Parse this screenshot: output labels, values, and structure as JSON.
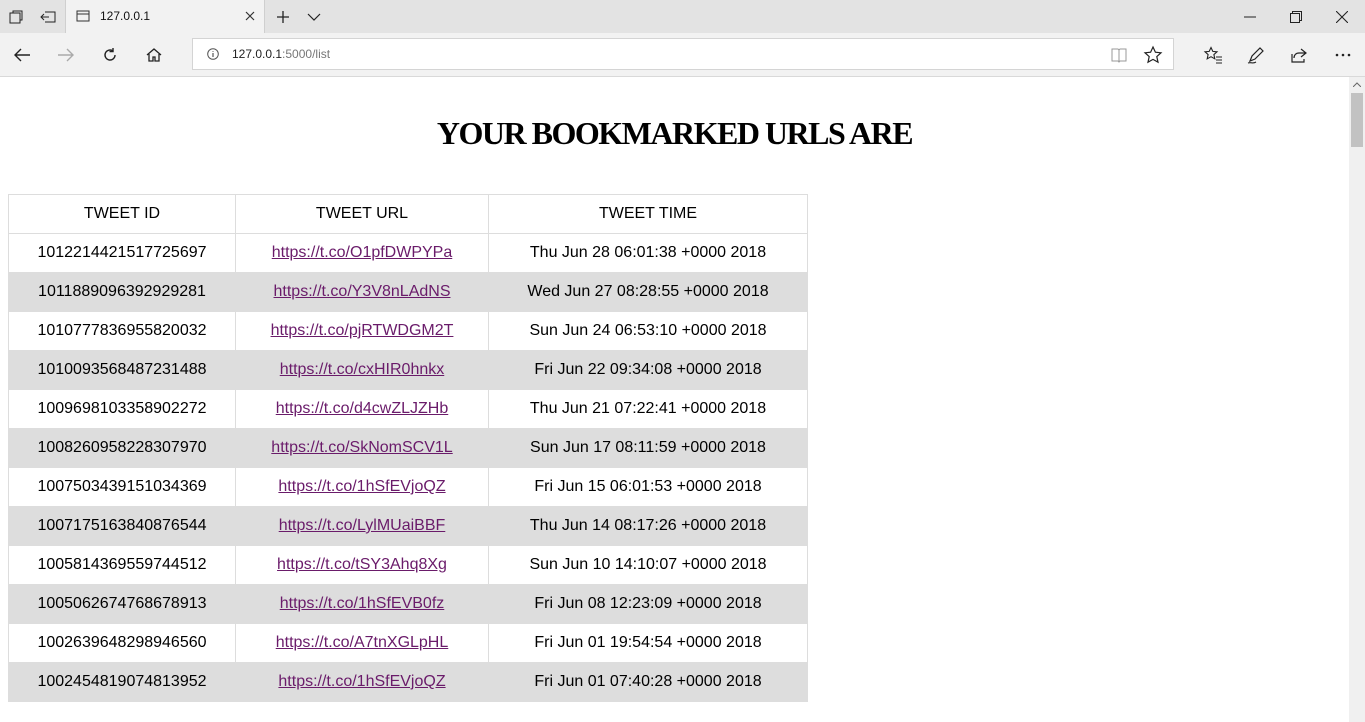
{
  "browser": {
    "tab_title": "127.0.0.1",
    "url_host": "127.0.0.1",
    "url_path": ":5000/list"
  },
  "page": {
    "heading": "YOUR BOOKMARKED URLS ARE",
    "columns": [
      "TWEET ID",
      "TWEET URL",
      "TWEET TIME"
    ],
    "link_color": "#6a1b6a",
    "stripe_color": "#dddddd",
    "rows": [
      {
        "id": "1012214421517725697",
        "url": "https://t.co/O1pfDWPYPa",
        "time": "Thu Jun 28 06:01:38 +0000 2018"
      },
      {
        "id": "1011889096392929281",
        "url": "https://t.co/Y3V8nLAdNS",
        "time": "Wed Jun 27 08:28:55 +0000 2018"
      },
      {
        "id": "1010777836955820032",
        "url": "https://t.co/pjRTWDGM2T",
        "time": "Sun Jun 24 06:53:10 +0000 2018"
      },
      {
        "id": "1010093568487231488",
        "url": "https://t.co/cxHIR0hnkx",
        "time": "Fri Jun 22 09:34:08 +0000 2018"
      },
      {
        "id": "1009698103358902272",
        "url": "https://t.co/d4cwZLJZHb",
        "time": "Thu Jun 21 07:22:41 +0000 2018"
      },
      {
        "id": "1008260958228307970",
        "url": "https://t.co/SkNomSCV1L",
        "time": "Sun Jun 17 08:11:59 +0000 2018"
      },
      {
        "id": "1007503439151034369",
        "url": "https://t.co/1hSfEVjoQZ",
        "time": "Fri Jun 15 06:01:53 +0000 2018"
      },
      {
        "id": "1007175163840876544",
        "url": "https://t.co/LylMUaiBBF",
        "time": "Thu Jun 14 08:17:26 +0000 2018"
      },
      {
        "id": "1005814369559744512",
        "url": "https://t.co/tSY3Ahq8Xg",
        "time": "Sun Jun 10 14:10:07 +0000 2018"
      },
      {
        "id": "1005062674768678913",
        "url": "https://t.co/1hSfEVB0fz",
        "time": "Fri Jun 08 12:23:09 +0000 2018"
      },
      {
        "id": "1002639648298946560",
        "url": "https://t.co/A7tnXGLpHL",
        "time": "Fri Jun 01 19:54:54 +0000 2018"
      },
      {
        "id": "1002454819074813952",
        "url": "https://t.co/1hSfEVjoQZ",
        "time": "Fri Jun 01 07:40:28 +0000 2018"
      }
    ]
  }
}
